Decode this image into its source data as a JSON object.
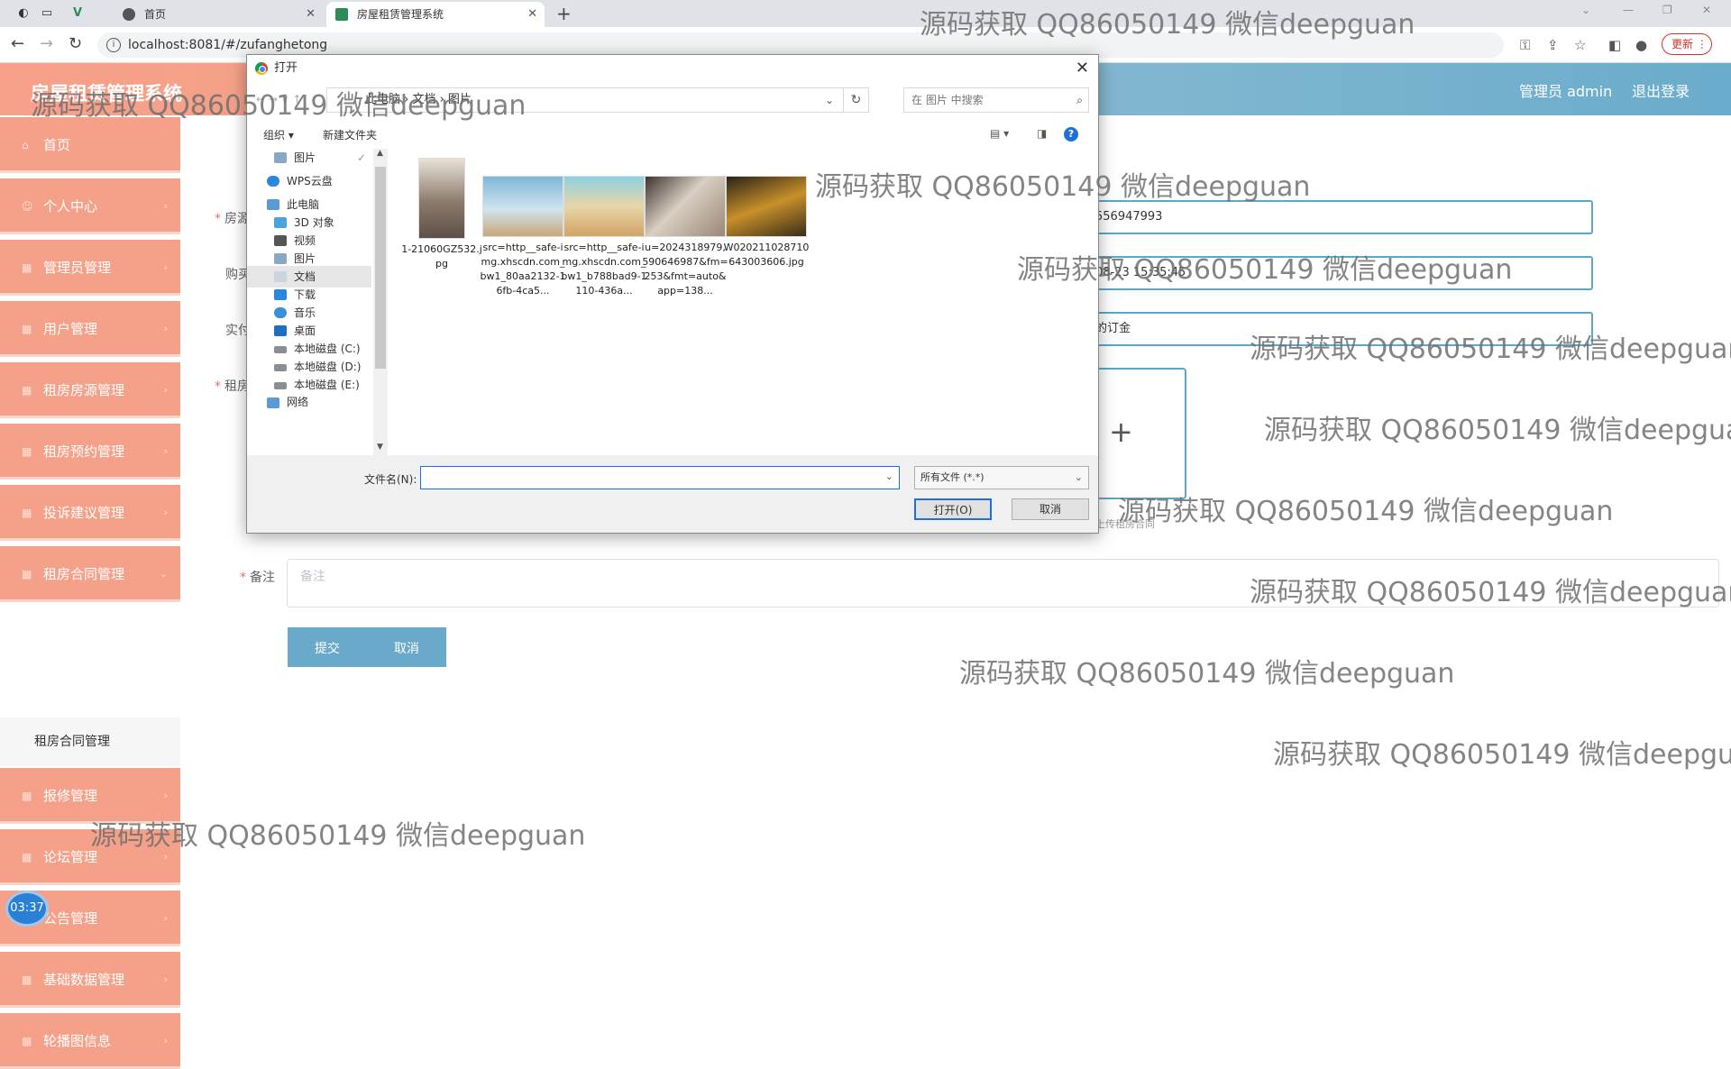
{
  "browser": {
    "tabs": [
      {
        "title": "首页"
      },
      {
        "title": "房屋租赁管理系统"
      }
    ],
    "new_tab": "+",
    "url": "localhost:8081/#/zufanghetong",
    "update_label": "更新"
  },
  "header": {
    "title": "房屋租赁管理系统",
    "user_label": "管理员 admin",
    "logout_label": "退出登录"
  },
  "sidebar": {
    "items": [
      {
        "label": "首页"
      },
      {
        "label": "个人中心"
      },
      {
        "label": "管理员管理"
      },
      {
        "label": "用户管理"
      },
      {
        "label": "租房房源管理"
      },
      {
        "label": "租房预约管理"
      },
      {
        "label": "投诉建议管理"
      },
      {
        "label": "租房合同管理"
      },
      {
        "label": "报修管理"
      },
      {
        "label": "论坛管理"
      },
      {
        "label": "公告管理"
      },
      {
        "label": "基础数据管理"
      },
      {
        "label": "轮播图信息"
      }
    ],
    "active_sub": "租房合同管理"
  },
  "form": {
    "label_1": "房源",
    "value_1": "556947993",
    "label_2": "购买",
    "value_2": "08-23 15:35:45",
    "label_3": "实付",
    "value_3": "的订金",
    "label_4": "租房",
    "upload_hint": "上传租房合同",
    "remark_label": "备注",
    "remark_placeholder": "备注",
    "submit_label": "提交",
    "cancel_label": "取消"
  },
  "dialog": {
    "title": "打开",
    "breadcrumb": "此电脑 › 文档 › 图片",
    "search_placeholder": "在 图片 中搜索",
    "organize_label": "组织 ▾",
    "new_folder_label": "新建文件夹",
    "nav_items": [
      {
        "label": "图片"
      },
      {
        "label": "WPS云盘"
      },
      {
        "label": "此电脑"
      },
      {
        "label": "3D 对象"
      },
      {
        "label": "视频"
      },
      {
        "label": "图片"
      },
      {
        "label": "文档"
      },
      {
        "label": "下载"
      },
      {
        "label": "音乐"
      },
      {
        "label": "桌面"
      },
      {
        "label": "本地磁盘 (C:)"
      },
      {
        "label": "本地磁盘 (D:)"
      },
      {
        "label": "本地磁盘 (E:)"
      },
      {
        "label": "网络"
      }
    ],
    "files": [
      {
        "name": "1-21060GZ532.jpg",
        "color": "#8b7a6b"
      },
      {
        "name": "src=http__safe-img.xhscdn.com_bw1_80aa2132-16fb-4ca5...",
        "color": "#7fb6d6"
      },
      {
        "name": "src=http__safe-img.xhscdn.com_bw1_b788bad9-1110-436a...",
        "color": "#d1a367"
      },
      {
        "name": "u=2024318979,590646987&fm=253&fmt=auto&app=138...",
        "color": "#9a8775"
      },
      {
        "name": "W020211028710643003606.jpg",
        "color": "#c8902a"
      }
    ],
    "filename_label": "文件名(N):",
    "filetype_label": "所有文件 (*.*)",
    "open_label": "打开(O)",
    "cancel_label": "取消"
  },
  "overlay": {
    "watermark": "源码获取 QQ86050149 微信deepguan",
    "timer": "03:37"
  }
}
